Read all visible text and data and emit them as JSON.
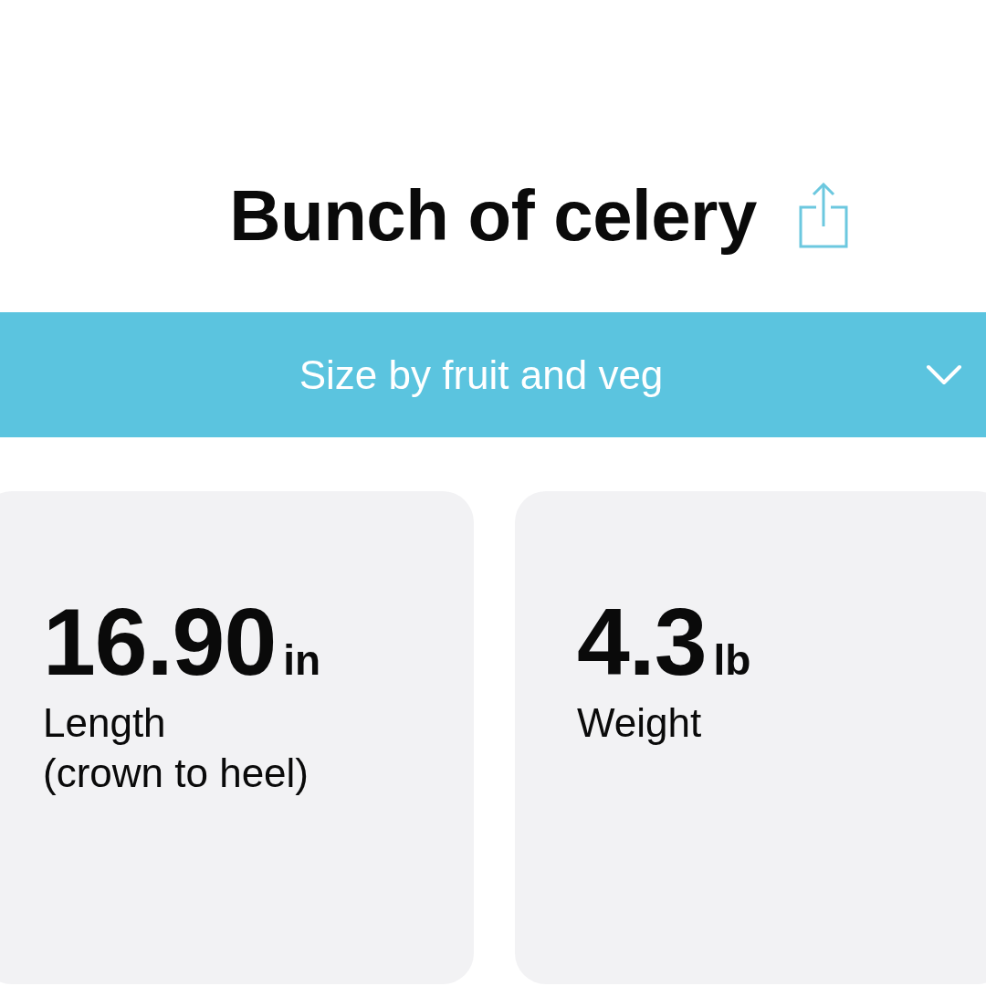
{
  "header": {
    "title": "Bunch of celery"
  },
  "size_selector": {
    "label": "Size by fruit and veg"
  },
  "measurements": [
    {
      "value": "16.90",
      "unit": "in",
      "label": "Length\n(crown to heel)"
    },
    {
      "value": "4.3",
      "unit": "lb",
      "label": "Weight"
    }
  ]
}
